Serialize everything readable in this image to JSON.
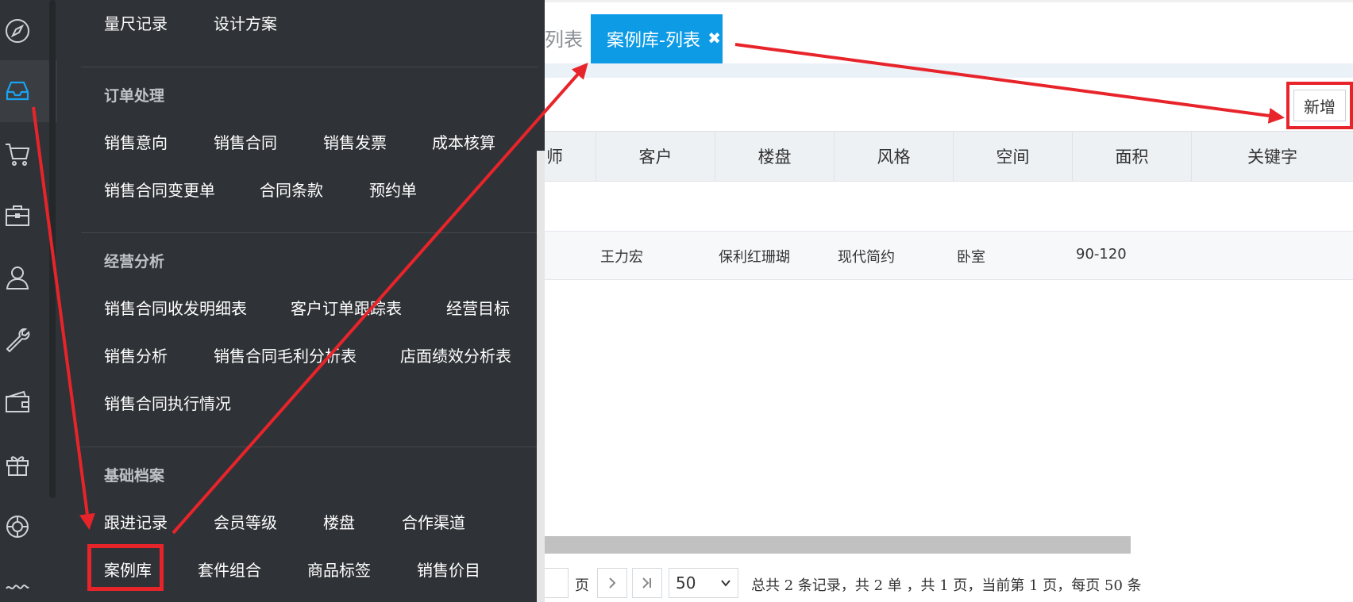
{
  "rail": {
    "icons": [
      "compass-icon",
      "inbox-icon",
      "cart-icon",
      "briefcase-icon",
      "user-icon",
      "wrench-icon",
      "wallet-icon",
      "gift-icon",
      "lifebuoy-icon",
      "more-icon"
    ]
  },
  "menu": {
    "top_items": [
      "量尺记录",
      "设计方案"
    ],
    "sections": [
      {
        "title": "订单处理",
        "items": [
          "销售意向",
          "销售合同",
          "销售发票",
          "成本核算",
          "销售合同变更单",
          "合同条款",
          "预约单"
        ]
      },
      {
        "title": "经营分析",
        "items": [
          "销售合同收发明细表",
          "客户订单跟踪表",
          "经营目标",
          "销售分析",
          "销售合同毛利分析表",
          "店面绩效分析表",
          "销售合同执行情况"
        ]
      },
      {
        "title": "基础档案",
        "items": [
          "跟进记录",
          "会员等级",
          "楼盘",
          "合作渠道",
          "案例库",
          "套件组合",
          "商品标签",
          "销售价目"
        ]
      }
    ]
  },
  "tabs": {
    "previous_fragment": "列表",
    "active_label": "案例库-列表",
    "close_glyph": "✖"
  },
  "toolbar": {
    "new_label": "新增"
  },
  "table": {
    "headers": [
      "师",
      "客户",
      "楼盘",
      "风格",
      "空间",
      "面积",
      "关键字"
    ],
    "row": [
      "王力宏",
      "保利红珊瑚",
      "现代简约",
      "卧室",
      "90-120"
    ]
  },
  "pager": {
    "page_suffix": "页",
    "page_size": "50",
    "summary": "总共 2 条记录，共 2 单 ，共 1 页，当前第 1 页，每页 50 条"
  },
  "colors": {
    "sidebar_bg": "#2f3236",
    "accent": "#0e9be6",
    "annotation_red": "#e8242b"
  }
}
